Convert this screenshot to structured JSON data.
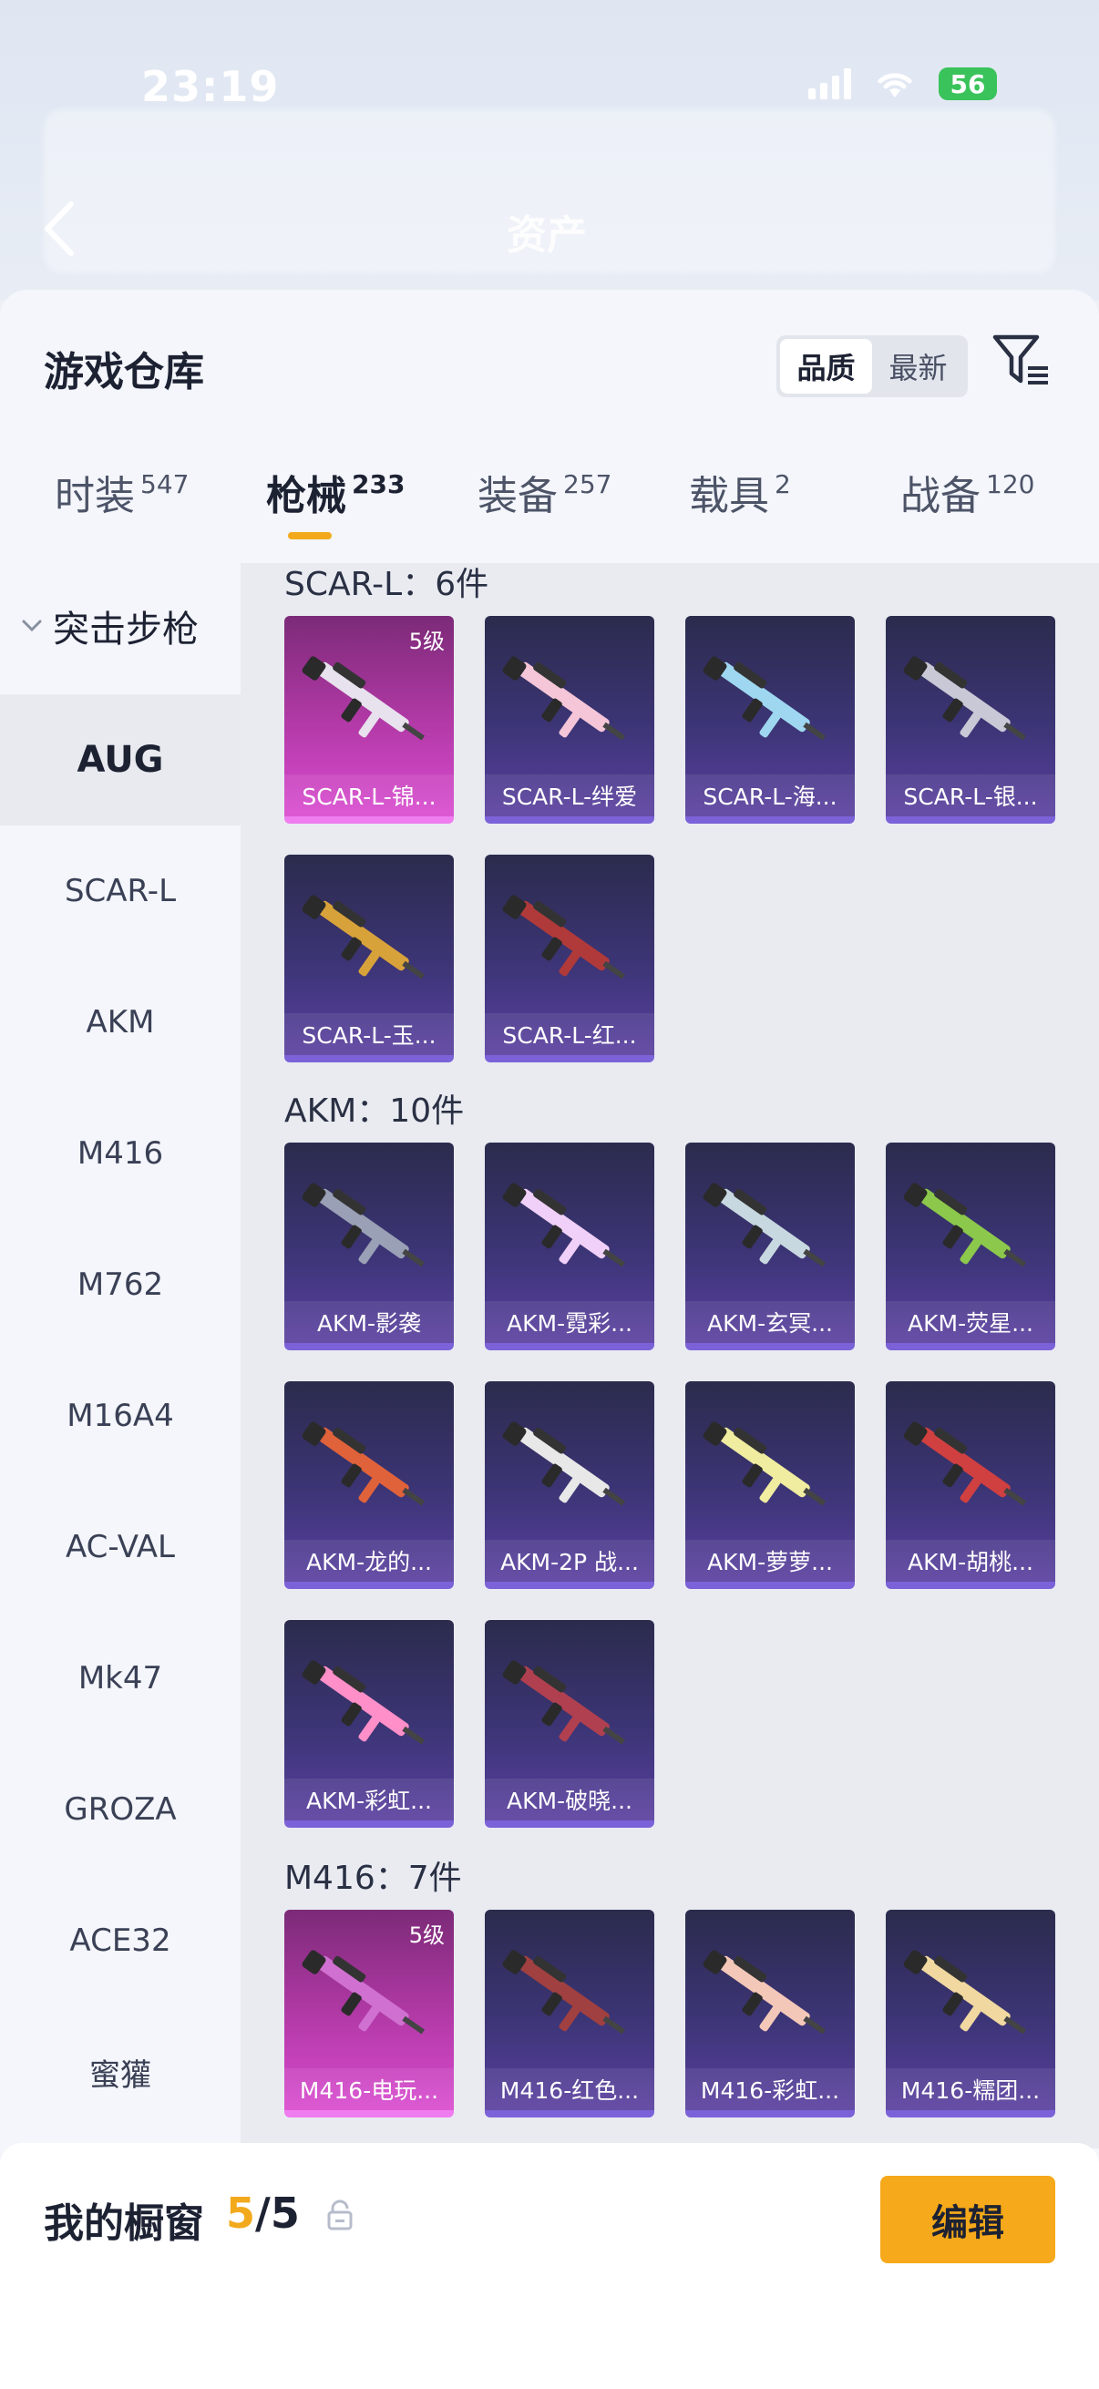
{
  "status_bar": {
    "time": "23:19",
    "battery": "56"
  },
  "header": {
    "title": "资产"
  },
  "sheet": {
    "title": "游戏仓库",
    "sort": {
      "options": [
        "品质",
        "最新"
      ],
      "selected": "品质"
    }
  },
  "tabs": [
    {
      "label": "时装",
      "count": "547"
    },
    {
      "label": "枪械",
      "count": "233",
      "active": true
    },
    {
      "label": "装备",
      "count": "257"
    },
    {
      "label": "载具",
      "count": "2"
    },
    {
      "label": "战备",
      "count": "120"
    }
  ],
  "sidenav": {
    "category": "突击步枪",
    "items": [
      "AUG",
      "SCAR-L",
      "AKM",
      "M416",
      "M762",
      "M16A4",
      "AC-VAL",
      "Mk47",
      "GROZA",
      "ACE32",
      "蜜獾"
    ],
    "active": "AUG"
  },
  "sections": [
    {
      "title": "SCAR-L：6件",
      "items": [
        {
          "label": "SCAR-L-锦...",
          "badge": "5级",
          "rarity": "gold"
        },
        {
          "label": "SCAR-L-绊爱",
          "rarity": "purple"
        },
        {
          "label": "SCAR-L-海...",
          "rarity": "purple"
        },
        {
          "label": "SCAR-L-银...",
          "rarity": "purple"
        },
        {
          "label": "SCAR-L-玉...",
          "rarity": "purple"
        },
        {
          "label": "SCAR-L-红...",
          "rarity": "purple"
        }
      ]
    },
    {
      "title": "AKM：10件",
      "items": [
        {
          "label": "AKM-影袭",
          "rarity": "purple"
        },
        {
          "label": "AKM-霓彩...",
          "rarity": "purple"
        },
        {
          "label": "AKM-玄冥...",
          "rarity": "purple"
        },
        {
          "label": "AKM-荧星...",
          "rarity": "purple"
        },
        {
          "label": "AKM-龙的...",
          "rarity": "purple"
        },
        {
          "label": "AKM-2P 战...",
          "rarity": "purple"
        },
        {
          "label": "AKM-萝萝...",
          "rarity": "purple"
        },
        {
          "label": "AKM-胡桃...",
          "rarity": "purple"
        },
        {
          "label": "AKM-彩虹...",
          "rarity": "purple"
        },
        {
          "label": "AKM-破晓...",
          "rarity": "purple"
        }
      ]
    },
    {
      "title": "M416：7件",
      "items": [
        {
          "label": "M416-电玩...",
          "badge": "5级",
          "rarity": "gold"
        },
        {
          "label": "M416-红色...",
          "rarity": "purple"
        },
        {
          "label": "M416-彩虹...",
          "rarity": "purple"
        },
        {
          "label": "M416-糯团...",
          "rarity": "purple"
        }
      ]
    }
  ],
  "bottom_bar": {
    "label": "我的橱窗",
    "current": "5",
    "total": "/5",
    "edit_label": "编辑"
  },
  "colors": {
    "accent": "#f3a91c",
    "card_purple": "#3c3576",
    "card_gold": "#b43aa8"
  }
}
